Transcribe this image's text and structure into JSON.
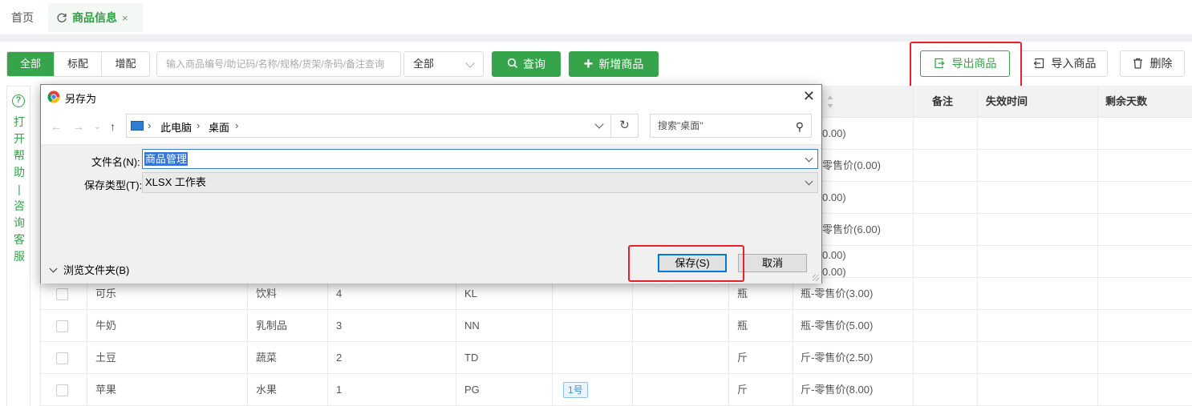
{
  "tabs": {
    "home": "首页",
    "active": "商品信息",
    "close": "×"
  },
  "filters": {
    "all": "全部",
    "tag1": "标配",
    "tag2": "增配"
  },
  "search": {
    "placeholder": "输入商品编号/助记码/名称/规格/货架/条码/备注查询"
  },
  "category_select": {
    "value": "全部"
  },
  "buttons": {
    "query": "查询",
    "new_product": "新增商品",
    "export": "导出商品",
    "import": "导入商品",
    "delete": "删除"
  },
  "help": {
    "icon": "?",
    "text": "打开帮助|咨询客服"
  },
  "table": {
    "headers": {
      "remark": "备注",
      "expire": "失效时间",
      "days_left": "剩余天数"
    },
    "hidden_prices": [
      "0.00)",
      "零售价(0.00)",
      "0.00)",
      "零售价(6.00)",
      "0.00)",
      "0.00)"
    ],
    "rows": [
      {
        "name": "可乐",
        "category": "饮料",
        "id": "4",
        "code": "KL",
        "tag": "",
        "unit": "瓶",
        "price": "瓶-零售价(3.00)"
      },
      {
        "name": "牛奶",
        "category": "乳制品",
        "id": "3",
        "code": "NN",
        "tag": "",
        "unit": "瓶",
        "price": "瓶-零售价(5.00)"
      },
      {
        "name": "土豆",
        "category": "蔬菜",
        "id": "2",
        "code": "TD",
        "tag": "",
        "unit": "斤",
        "price": "斤-零售价(2.50)"
      },
      {
        "name": "苹果",
        "category": "水果",
        "id": "1",
        "code": "PG",
        "tag": "1号",
        "unit": "斤",
        "price": "斤-零售价(8.00)"
      }
    ]
  },
  "dialog": {
    "title": "另存为",
    "breadcrumb": [
      "此电脑",
      "桌面"
    ],
    "search_placeholder": "搜索\"桌面\"",
    "filename_label": "文件名(N):",
    "filename_value": "商品管理",
    "filetype_label": "保存类型(T):",
    "filetype_value": "XLSX 工作表",
    "browse_folders": "浏览文件夹(B)",
    "save": "保存(S)",
    "cancel": "取消"
  },
  "colors": {
    "accent": "#35a44a",
    "highlight": "#e8202a",
    "selection": "#3875d7"
  }
}
